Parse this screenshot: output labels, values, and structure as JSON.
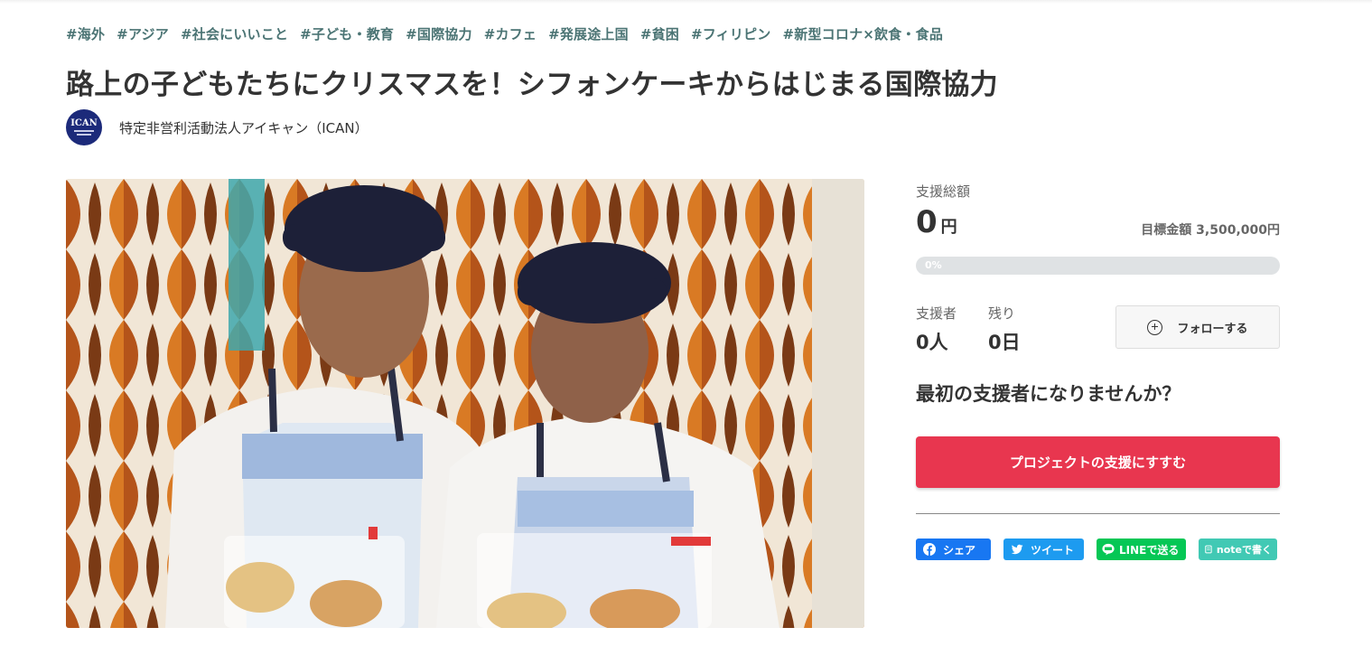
{
  "tags": [
    "#海外",
    "#アジア",
    "#社会にいいこと",
    "#子ども・教育",
    "#国際協力",
    "#カフェ",
    "#発展途上国",
    "#貧困",
    "#フィリピン",
    "#新型コロナ×飲食・食品"
  ],
  "project": {
    "title": "路上の子どもたちにクリスマスを！シフォンケーキからはじまる国際協力",
    "owner_name": "特定非営利活動法人アイキャン（ICAN）",
    "owner_logo_text": "ICAN"
  },
  "funding": {
    "total_label": "支援総額",
    "total_amount": "0",
    "total_unit": "円",
    "goal_text": "目標金額 3,500,000円",
    "progress_percent": 0,
    "progress_text": "0%",
    "supporters_label": "支援者",
    "supporters_value": "0人",
    "remaining_label": "残り",
    "remaining_value": "0日"
  },
  "follow": {
    "label": "フォローする",
    "icon": "plus-circle-icon"
  },
  "cta": {
    "prompt": "最初の支援者になりませんか？",
    "button_label": "プロジェクトの支援にすすむ"
  },
  "share": {
    "facebook_label": "シェア",
    "twitter_label": "ツイート",
    "line_label": "LINEで送る",
    "note_label": "noteで書く"
  },
  "colors": {
    "accent": "#e8364f",
    "tag": "#4b7474",
    "facebook": "#1877f2",
    "twitter": "#1d9bf0",
    "line": "#06c755",
    "note": "#41c9b4"
  }
}
